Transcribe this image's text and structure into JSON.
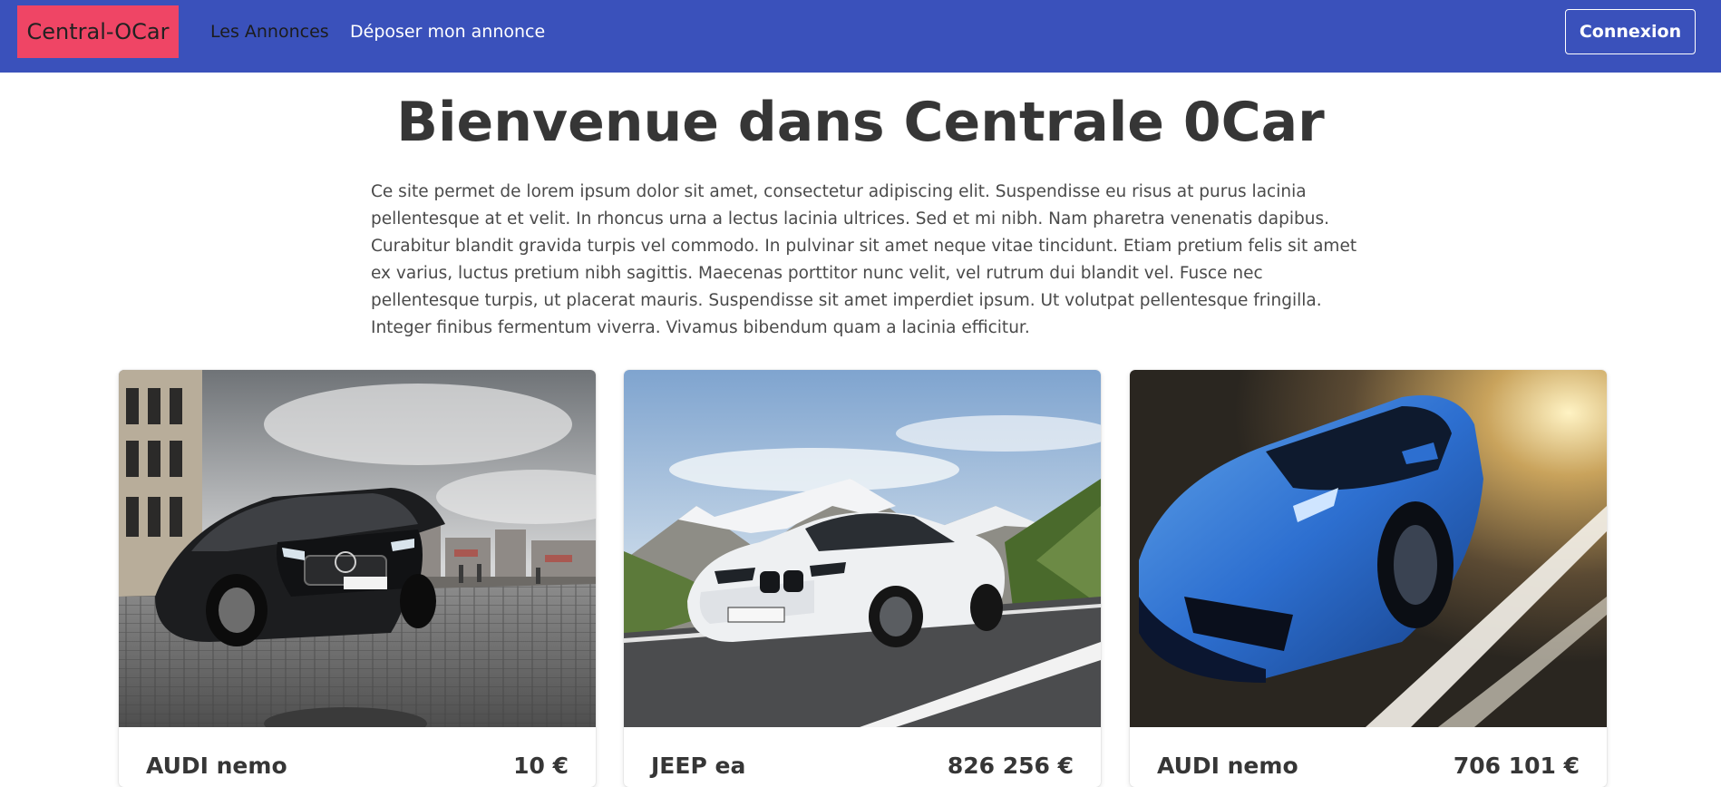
{
  "navbar": {
    "brand": "Central-OCar",
    "links": [
      {
        "label": "Les Annonces"
      },
      {
        "label": "Déposer mon annonce"
      }
    ],
    "login_label": "Connexion",
    "colors": {
      "background": "#3a51bb",
      "brand_bg": "#ef4565"
    }
  },
  "hero": {
    "title": "Bienvenue dans Centrale 0Car",
    "description": "Ce site permet de lorem ipsum dolor sit amet, consectetur adipiscing elit. Suspendisse eu risus at purus lacinia pellentesque at et velit. In rhoncus urna a lectus lacinia ultrices. Sed et mi nibh. Nam pharetra venenatis dapibus. Curabitur blandit gravida turpis vel commodo. In pulvinar sit amet neque vitae tincidunt. Etiam pretium felis sit amet ex varius, luctus pretium nibh sagittis. Maecenas porttitor nunc velit, vel rutrum dui blandit vel. Fusce nec pellentesque turpis, ut placerat mauris. Suspendisse sit amet imperdiet ipsum. Ut volutpat pellentesque fringilla. Integer finibus fermentum viverra. Vivamus bibendum quam a lacinia efficitur."
  },
  "listings": [
    {
      "name": "AUDI nemo",
      "price": "10 €",
      "image": "black-sedan-photo"
    },
    {
      "name": "JEEP ea",
      "price": "826 256 €",
      "image": "white-coupe-photo"
    },
    {
      "name": "AUDI nemo",
      "price": "706 101 €",
      "image": "blue-supercar-photo"
    }
  ]
}
